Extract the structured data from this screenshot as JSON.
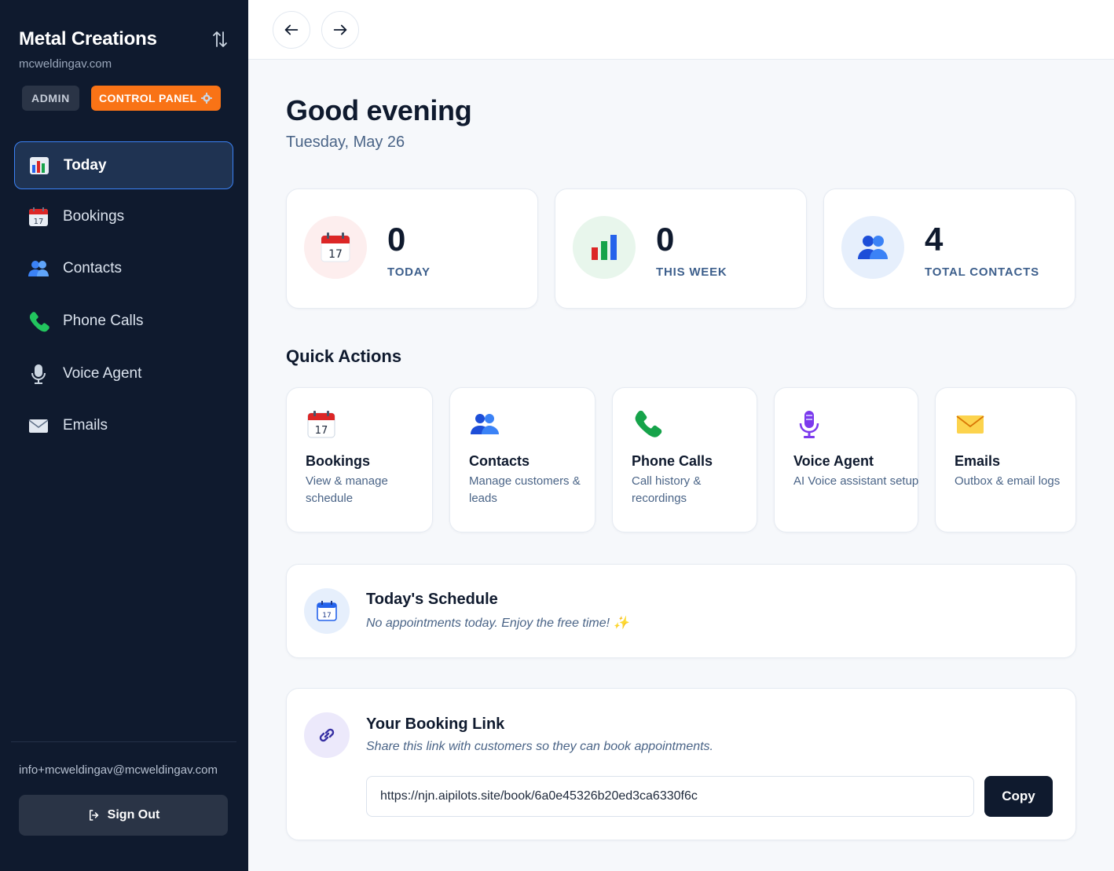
{
  "sidebar": {
    "brand": "Metal Creations",
    "domain": "mcweldingav.com",
    "badge_admin": "ADMIN",
    "badge_control_panel": "CONTROL PANEL",
    "items": [
      {
        "label": "Today",
        "icon": "bar-chart-icon",
        "active": true
      },
      {
        "label": "Bookings",
        "icon": "calendar-icon",
        "active": false
      },
      {
        "label": "Contacts",
        "icon": "users-icon",
        "active": false
      },
      {
        "label": "Phone Calls",
        "icon": "phone-icon",
        "active": false
      },
      {
        "label": "Voice Agent",
        "icon": "microphone-icon",
        "active": false
      },
      {
        "label": "Emails",
        "icon": "envelope-icon",
        "active": false
      }
    ],
    "user_email": "info+mcweldingav@mcweldingav.com",
    "sign_out_label": "Sign Out"
  },
  "header": {
    "greeting": "Good evening",
    "date": "Tuesday, May 26"
  },
  "stats": [
    {
      "value": "0",
      "label": "TODAY",
      "icon": "calendar-icon"
    },
    {
      "value": "0",
      "label": "THIS WEEK",
      "icon": "bar-chart-icon"
    },
    {
      "value": "4",
      "label": "TOTAL CONTACTS",
      "icon": "users-icon"
    }
  ],
  "quick_actions": {
    "title": "Quick Actions",
    "items": [
      {
        "title": "Bookings",
        "desc": "View & manage schedule",
        "icon": "calendar-icon"
      },
      {
        "title": "Contacts",
        "desc": "Manage customers & leads",
        "icon": "users-icon"
      },
      {
        "title": "Phone Calls",
        "desc": "Call history & recordings",
        "icon": "phone-icon"
      },
      {
        "title": "Voice Agent",
        "desc": "AI Voice assistant setup",
        "icon": "microphone-icon"
      },
      {
        "title": "Emails",
        "desc": "Outbox & email logs",
        "icon": "envelope-icon"
      }
    ]
  },
  "schedule": {
    "title": "Today's Schedule",
    "message": "No appointments today. Enjoy the free time! ✨"
  },
  "booking_link": {
    "title": "Your Booking Link",
    "subtitle": "Share this link with customers so they can book appointments.",
    "url": "https://njn.aipilots.site/book/6a0e45326b20ed3ca6330f6c",
    "copy_label": "Copy"
  },
  "colors": {
    "sidebar_bg": "#0f1a2e",
    "accent_orange": "#f97316",
    "active_border": "#3b82f6",
    "label_blue": "#3d5f8c"
  }
}
